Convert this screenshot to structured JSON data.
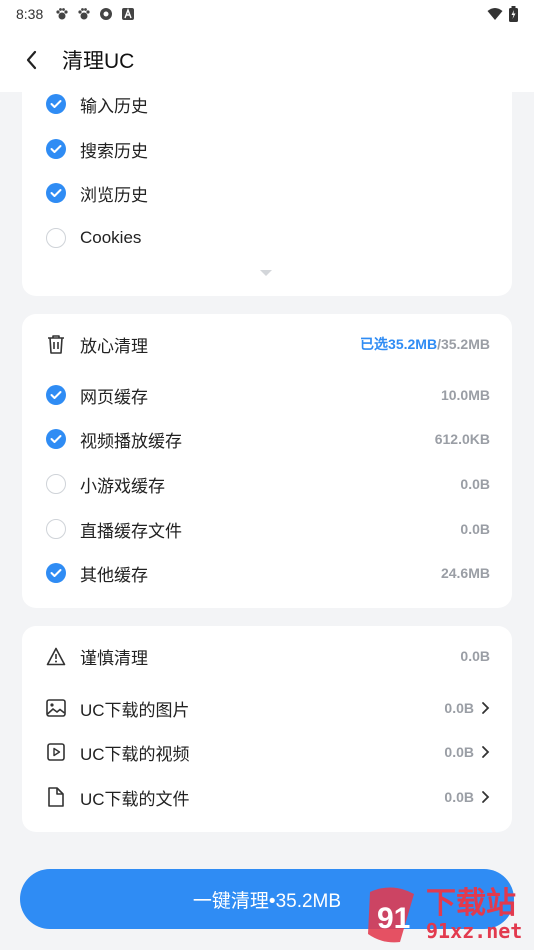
{
  "status_bar": {
    "time": "8:38",
    "icons": [
      "paw-icon",
      "paw-icon",
      "aperture-icon",
      "a-box-icon"
    ],
    "right_icons": [
      "wifi-icon",
      "battery-icon"
    ]
  },
  "header": {
    "title": "清理UC"
  },
  "history": {
    "items": [
      {
        "label": "输入历史",
        "checked": true
      },
      {
        "label": "搜索历史",
        "checked": true
      },
      {
        "label": "浏览历史",
        "checked": true
      },
      {
        "label": "Cookies",
        "checked": false
      }
    ]
  },
  "safe_clean": {
    "title": "放心清理",
    "selected": "已选35.2MB",
    "total": "/35.2MB",
    "items": [
      {
        "label": "网页缓存",
        "value": "10.0MB",
        "checked": true
      },
      {
        "label": "视频播放缓存",
        "value": "612.0KB",
        "checked": true
      },
      {
        "label": "小游戏缓存",
        "value": "0.0B",
        "checked": false
      },
      {
        "label": "直播缓存文件",
        "value": "0.0B",
        "checked": false
      },
      {
        "label": "其他缓存",
        "value": "24.6MB",
        "checked": true
      }
    ]
  },
  "careful_clean": {
    "title": "谨慎清理",
    "total": "0.0B",
    "items": [
      {
        "label": "UC下载的图片",
        "value": "0.0B",
        "icon": "image-icon"
      },
      {
        "label": "UC下载的视频",
        "value": "0.0B",
        "icon": "video-icon"
      },
      {
        "label": "UC下载的文件",
        "value": "0.0B",
        "icon": "file-icon"
      }
    ]
  },
  "action": {
    "clean_label": "一键清理•35.2MB"
  },
  "watermark": {
    "brand": "下载站",
    "domain": "91xz.net"
  },
  "colors": {
    "accent": "#2f8cf4",
    "muted": "#9a9ea5",
    "watermark": "#e23a4e"
  }
}
